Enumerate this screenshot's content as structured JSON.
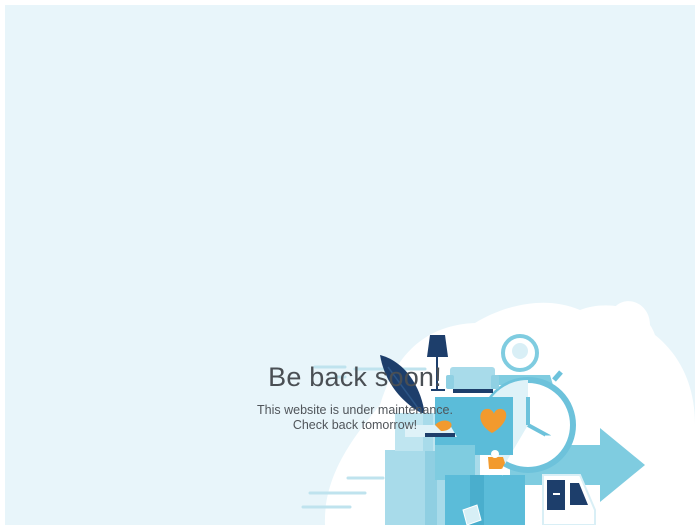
{
  "maintenance": {
    "headline": "Be back soon!",
    "message_line_1": "This website is under maintenance.",
    "message_line_2": "Check back tomorrow!"
  },
  "illustration": {
    "name": "maintenance-illustration",
    "icons": [
      "floor-lamp-icon",
      "sofa-icon",
      "stopwatch-icon",
      "truck-icon",
      "arrow-right-icon",
      "plant-icon",
      "heart-icon",
      "dog-icon",
      "box-icon"
    ]
  },
  "colors": {
    "page_background": "#e8f5fa",
    "cloud": "#ffffff",
    "primary_blue": "#5bbcd9",
    "light_blue": "#a8dbea",
    "dark_navy": "#1d3e6b",
    "accent_orange": "#f29a2e",
    "headline_text": "#4a4f54"
  }
}
